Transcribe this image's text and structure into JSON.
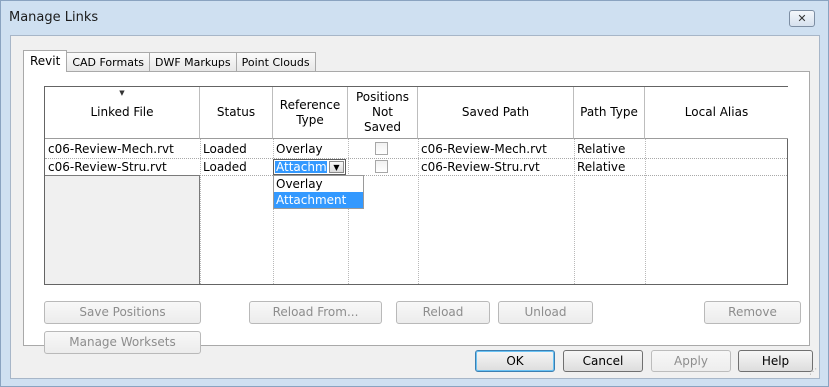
{
  "window": {
    "title": "Manage Links",
    "close_label": "✕"
  },
  "tabs": [
    "Revit",
    "CAD Formats",
    "DWF Markups",
    "Point Clouds"
  ],
  "table": {
    "sort_arrow": "▼",
    "headers": [
      "Linked File",
      "Status",
      "Reference Type",
      "Positions Not Saved",
      "Saved Path",
      "Path Type",
      "Local Alias"
    ],
    "rows": [
      {
        "file": "c06-Review-Mech.rvt",
        "status": "Loaded",
        "ref_type": "Overlay",
        "positions_not_saved": false,
        "saved_path": "c06-Review-Mech.rvt",
        "path_type": "Relative",
        "alias": ""
      },
      {
        "file": "c06-Review-Stru.rvt",
        "status": "Loaded",
        "ref_type": "Attachm",
        "positions_not_saved": false,
        "saved_path": "c06-Review-Stru.rvt",
        "path_type": "Relative",
        "alias": ""
      }
    ]
  },
  "dropdown": {
    "arrow": "▼",
    "options": [
      "Overlay",
      "Attachment"
    ],
    "selected": "Attachment"
  },
  "buttons": {
    "save_positions": "Save Positions",
    "reload_from": "Reload From...",
    "reload": "Reload",
    "unload": "Unload",
    "remove": "Remove",
    "manage_worksets": "Manage Worksets"
  },
  "dialog_buttons": {
    "ok": "OK",
    "cancel": "Cancel",
    "apply": "Apply",
    "help": "Help"
  },
  "colors": {
    "selection": "#3399ff",
    "frame": "#cfe0f1"
  },
  "icons": {
    "resize_grip": "⋰"
  }
}
